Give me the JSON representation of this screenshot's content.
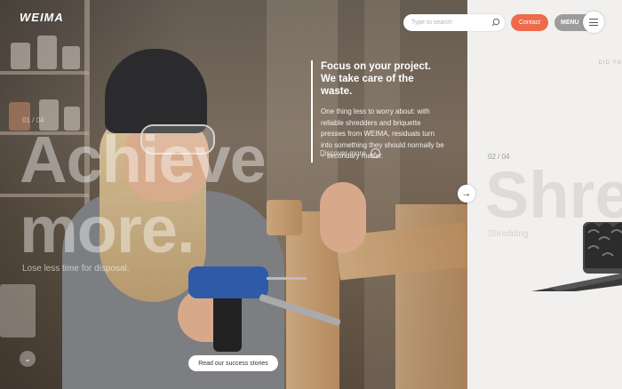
{
  "brand": {
    "logo_text": "WEIMA"
  },
  "header": {
    "search_placeholder": "Type to search",
    "contact_label": "Contact",
    "menu_label": "MENU"
  },
  "slide_current": {
    "counter": "01 / 04",
    "headline_line1": "Achieve",
    "headline_line2": "more.",
    "tagline": "Lose less time for disposal.",
    "feature_title": "Focus on your project. We take care of the waste.",
    "feature_text": "One thing less to worry about: with reliable shredders and briquette presses from WEIMA, residuals turn into something they should normally be – secondary matter.",
    "discover_label": "Discover more",
    "success_button": "Read our success stories"
  },
  "slide_next": {
    "counter": "02 / 04",
    "headline": "Shre",
    "subtitle": "Shredding",
    "side_note": "DID YO"
  },
  "icons": [
    "search-icon",
    "menu-icon",
    "arrow-right-icon",
    "chevron-down-icon",
    "circle-arrow-icon"
  ],
  "colors": {
    "accent": "#ef6a4b",
    "menu_bg": "#9c9c9c",
    "panel_bg": "#f1f0ee"
  }
}
